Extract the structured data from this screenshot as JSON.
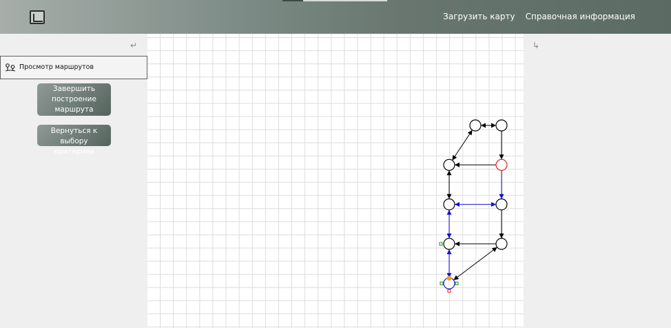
{
  "header": {
    "logo_icon": "map-logo-icon",
    "nav": [
      {
        "label": "Загрузить карту"
      },
      {
        "label": "Справочная информация"
      }
    ]
  },
  "left_panel": {
    "undo_icon": "undo-icon",
    "mode": {
      "icon": "route-pins-icon",
      "label": "Просмотр маршрутов"
    },
    "finish_button": "Завершить построение маршрута",
    "back_button": "Вернуться к выбору критериев"
  },
  "right_panel": {
    "redo_icon": "redo-icon"
  },
  "graph": {
    "colors": {
      "node": "#000000",
      "highlight_node": "#e02020",
      "selected_node": "#1a1acc",
      "black_edge": "#000000",
      "blue_edge": "#1010dd",
      "handle_orange": "#f0a020",
      "handle_green": "#1a8a1a",
      "handle_red": "#dd2020"
    },
    "nodes": [
      {
        "id": "A",
        "col": 1,
        "row": 0,
        "style": "normal"
      },
      {
        "id": "B",
        "col": 2,
        "row": 0,
        "style": "normal"
      },
      {
        "id": "C",
        "col": 0,
        "row": 1,
        "style": "normal"
      },
      {
        "id": "D",
        "col": 2,
        "row": 1,
        "style": "highlight"
      },
      {
        "id": "E",
        "col": 0,
        "row": 2,
        "style": "normal"
      },
      {
        "id": "F",
        "col": 2,
        "row": 2,
        "style": "normal"
      },
      {
        "id": "G",
        "col": 0,
        "row": 3,
        "style": "normal"
      },
      {
        "id": "H",
        "col": 2,
        "row": 3,
        "style": "normal"
      },
      {
        "id": "I",
        "col": 0,
        "row": 4,
        "style": "selected"
      }
    ],
    "edges": [
      {
        "from": "A",
        "to": "B",
        "color": "black",
        "both": true
      },
      {
        "from": "A",
        "to": "C",
        "color": "black",
        "both": true
      },
      {
        "from": "B",
        "to": "D",
        "color": "black",
        "both": false
      },
      {
        "from": "D",
        "to": "C",
        "color": "black",
        "both": false
      },
      {
        "from": "C",
        "to": "E",
        "color": "black",
        "both": true
      },
      {
        "from": "D",
        "to": "F",
        "color": "blue",
        "both": false
      },
      {
        "from": "E",
        "to": "F",
        "color": "blue",
        "both": true
      },
      {
        "from": "E",
        "to": "G",
        "color": "blue",
        "both": true
      },
      {
        "from": "F",
        "to": "H",
        "color": "black",
        "both": false
      },
      {
        "from": "H",
        "to": "G",
        "color": "black",
        "both": false
      },
      {
        "from": "G",
        "to": "I",
        "color": "blue",
        "both": true
      },
      {
        "from": "H",
        "to": "I",
        "color": "black",
        "both": true
      }
    ]
  }
}
